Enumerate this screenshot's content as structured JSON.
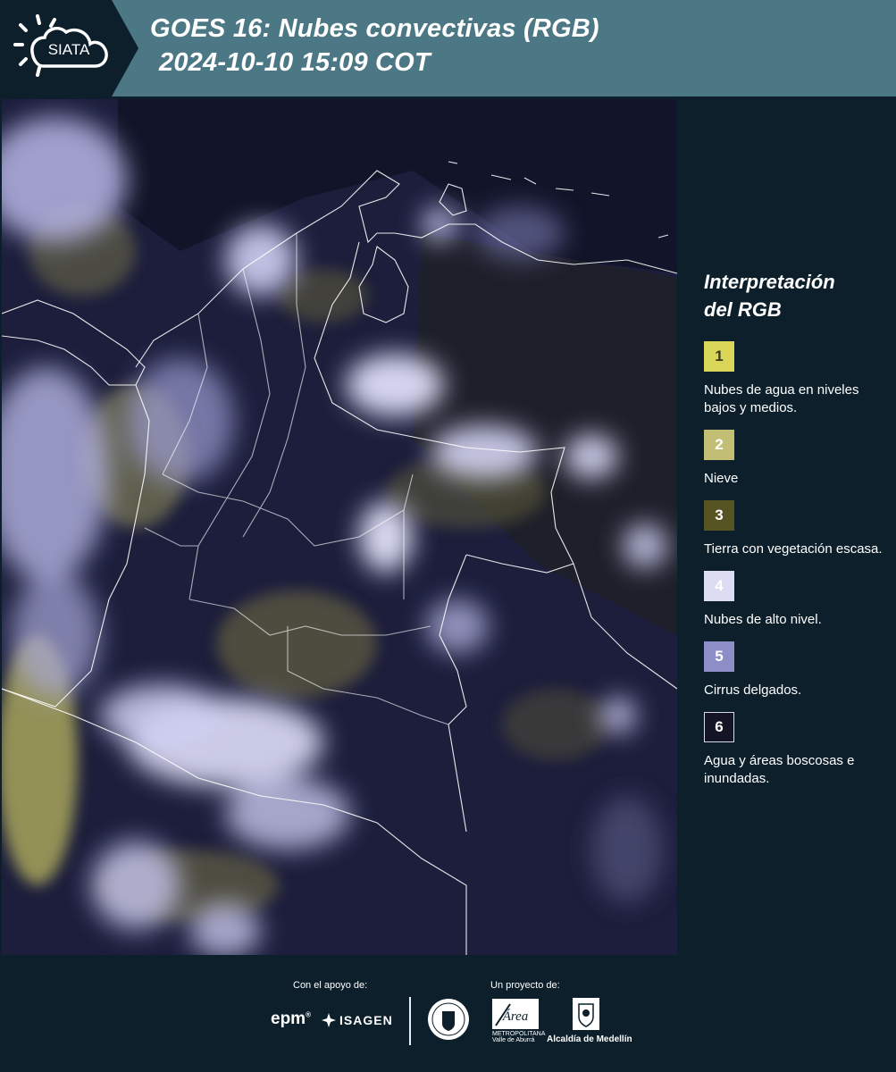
{
  "header": {
    "logo_text": "SIATA",
    "title_line1": "GOES 16: Nubes convectivas (RGB)",
    "title_line2": "2024-10-10 15:09 COT"
  },
  "legend": {
    "title_line1": "Interpretación",
    "title_line2": "del RGB",
    "items": [
      {
        "number": "1",
        "label": "Nubes de agua en niveles bajos y medios.",
        "swatch_color": "#d9d65a",
        "text_color": "#3a3a1e"
      },
      {
        "number": "2",
        "label": "Nieve",
        "swatch_color": "#c2bf75",
        "text_color": "#ffffff"
      },
      {
        "number": "3",
        "label": "Tierra con vegetación escasa.",
        "swatch_color": "#575424",
        "text_color": "#ffffff"
      },
      {
        "number": "4",
        "label": "Nubes de alto nivel.",
        "swatch_color": "#dcdcf2",
        "text_color": "#ffffff"
      },
      {
        "number": "5",
        "label": "Cirrus delgados.",
        "swatch_color": "#8d8dc8",
        "text_color": "#ffffff"
      },
      {
        "number": "6",
        "label": "Agua y áreas boscosas e inundadas.",
        "swatch_color": "#131526",
        "text_color": "#ffffff"
      }
    ]
  },
  "footer": {
    "support_caption": "Con el apoyo de:",
    "project_caption": "Un proyecto de:",
    "sponsor_epm": "epm",
    "sponsor_isagen": "ISAGEN",
    "area_logo_text": "Área",
    "area_logo_sub": "METROPOLITANA Valle de Aburrá",
    "alcaldia_label": "Alcaldía de Medellín"
  },
  "colors": {
    "header_band": "#4c7885",
    "background": "#0c1f2b",
    "boundary_lines": "#ffffff"
  },
  "icons": {
    "logo": "sun-cloud-logo-icon",
    "isagen": "isagen-star-icon",
    "seal": "medellin-seal-icon",
    "alcaldia": "alcaldia-coat-of-arms-icon"
  }
}
